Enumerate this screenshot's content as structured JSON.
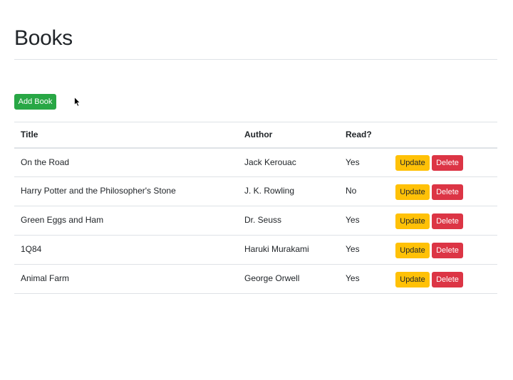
{
  "page": {
    "title": "Books"
  },
  "toolbar": {
    "add_label": "Add Book"
  },
  "table": {
    "headers": {
      "title": "Title",
      "author": "Author",
      "read": "Read?",
      "actions": ""
    },
    "rows": [
      {
        "title": "On the Road",
        "author": "Jack Kerouac",
        "read": "Yes"
      },
      {
        "title": "Harry Potter and the Philosopher's Stone",
        "author": "J. K. Rowling",
        "read": "No"
      },
      {
        "title": "Green Eggs and Ham",
        "author": "Dr. Seuss",
        "read": "Yes"
      },
      {
        "title": "1Q84",
        "author": "Haruki Murakami",
        "read": "Yes"
      },
      {
        "title": "Animal Farm",
        "author": "George Orwell",
        "read": "Yes"
      }
    ],
    "update_label": "Update",
    "delete_label": "Delete"
  },
  "colors": {
    "add_button": "#28a745",
    "update_button": "#ffc107",
    "delete_button": "#dc3545",
    "rule": "#dee2e6"
  },
  "icons": {
    "cursor": "mouse-pointer-icon"
  }
}
